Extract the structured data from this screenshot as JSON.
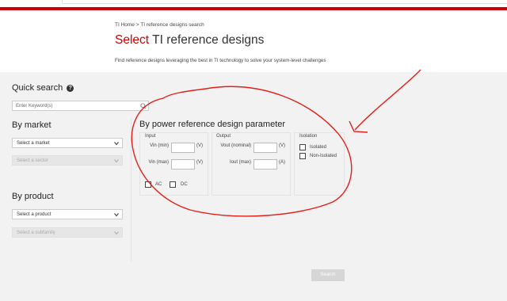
{
  "breadcrumb": {
    "home": "TI Home",
    "separator": ">",
    "current": "TI reference designs search"
  },
  "page_title": {
    "prefix": "Select",
    "rest": "TI reference designs"
  },
  "tagline": "Find reference designs leveraging the best in TI technology to solve your system-level challenges",
  "quick_search": {
    "heading": "Quick search",
    "help_icon": "?",
    "keyword_placeholder": "Enter Keyword(s)"
  },
  "by_market": {
    "heading": "By market",
    "market_select": "Select a market",
    "sector_select": "Select a sector"
  },
  "by_product": {
    "heading": "By product",
    "product_select": "Select a product",
    "subfamily_select": "Select a subfamily"
  },
  "power": {
    "heading": "By power reference design parameter",
    "input": {
      "label": "Input",
      "vin_min": "Vin (min)",
      "vin_max": "Vin (max)",
      "unit_v": "(V)",
      "ac": "AC",
      "dc": "DC"
    },
    "output": {
      "label": "Output",
      "vout": "Vout (nominal)",
      "iout": "Iout (max)",
      "unit_v": "(V)",
      "unit_a": "(A)"
    },
    "isolation": {
      "label": "Isolation",
      "isolated": "Isolated",
      "non_isolated": "Non-Isolated"
    }
  },
  "search_button": "Search",
  "colors": {
    "brand_red": "#cc0000",
    "annotation_red": "#e0201a",
    "background": "#f2f2f2"
  }
}
